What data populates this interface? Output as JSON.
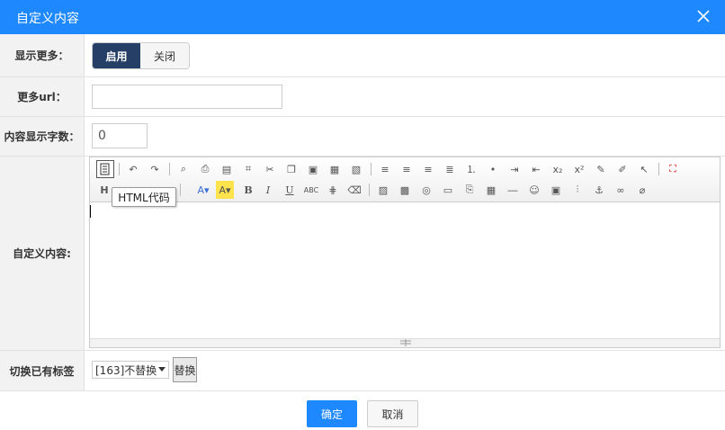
{
  "dialog": {
    "title": "自定义内容",
    "close_icon": "close-icon"
  },
  "rows": {
    "show_more": {
      "label": "显示更多：",
      "on": "启用",
      "off": "关闭"
    },
    "more_url": {
      "label": "更多url：",
      "value": ""
    },
    "char_count": {
      "label": "内容显示字数：",
      "value": "0"
    },
    "custom_content": {
      "label": "自定义内容:"
    },
    "switch_tag": {
      "label": "切换已有标签",
      "selected": "[163]不替换",
      "replace_button": "替换"
    }
  },
  "editor": {
    "tooltip": "HTML代码",
    "heading_glyph": "H",
    "toolbar_row1": [
      "html-source-icon",
      "undo-icon",
      "redo-icon",
      "preview-icon",
      "print-icon",
      "template-icon",
      "code-icon",
      "cut-icon",
      "copy-icon",
      "paste-icon",
      "paste-text-icon",
      "paste-word-icon",
      "align-left-icon",
      "align-center-icon",
      "align-right-icon",
      "align-justify-icon",
      "ordered-list-icon",
      "unordered-list-icon",
      "indent-icon",
      "outdent-icon",
      "subscript-icon",
      "superscript-icon",
      "clear-format-icon",
      "select-all-icon",
      "pointer-icon",
      "fullscreen-icon"
    ],
    "toolbar_row2": [
      "heading-icon",
      "font-color-icon",
      "highlight-icon",
      "bold-icon",
      "italic-icon",
      "underline-icon",
      "strikethrough-icon",
      "line-height-icon",
      "eraser-icon",
      "image-icon",
      "multi-image-icon",
      "flash-icon",
      "media-icon",
      "attachment-icon",
      "table-icon",
      "hr-icon",
      "emoticon-icon",
      "special-char-icon",
      "pagebreak-icon",
      "anchor-icon",
      "link-icon",
      "unlink-icon"
    ]
  },
  "footer": {
    "ok": "确定",
    "cancel": "取消"
  },
  "colors": {
    "accent": "#1e88ff",
    "toggle_on": "#263f66"
  }
}
